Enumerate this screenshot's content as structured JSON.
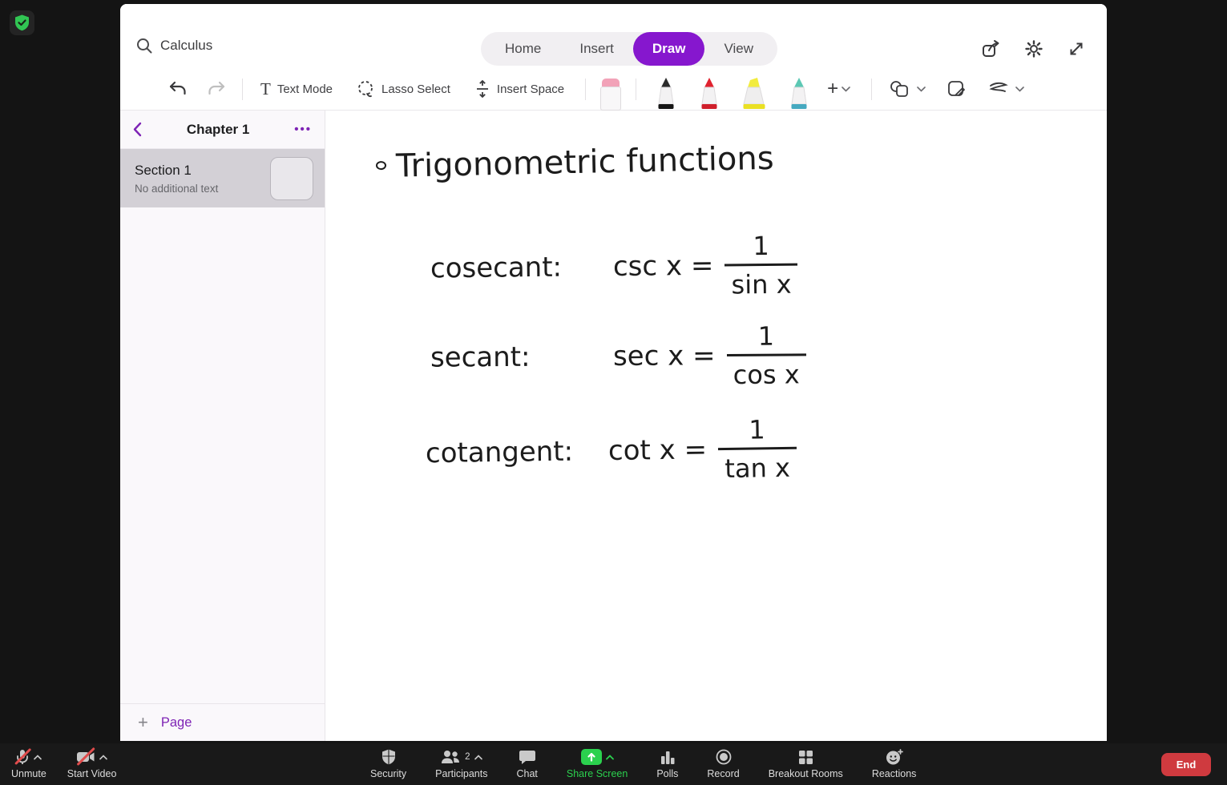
{
  "colors": {
    "accent_purple": "#8617ce",
    "sidebar_purple": "#7e23b5",
    "share_green": "#2bd14e",
    "end_red": "#cf3a3f",
    "shield_green": "#31c553",
    "ink": "#1c1c1c"
  },
  "notebook": {
    "search": {
      "value": "Calculus",
      "icon": "search-icon"
    },
    "tabs": [
      {
        "label": "Home",
        "active": false
      },
      {
        "label": "Insert",
        "active": false
      },
      {
        "label": "Draw",
        "active": true
      },
      {
        "label": "View",
        "active": false
      }
    ],
    "window_icons": [
      "share-icon",
      "settings-gear-icon",
      "expand-icon"
    ],
    "draw_toolbar": {
      "undo_icon": "undo-arrow",
      "redo_icon": "redo-arrow",
      "text_mode": "Text Mode",
      "lasso_select": "Lasso Select",
      "insert_space": "Insert Space",
      "pens": [
        "eraser",
        "black-pen",
        "red-pen",
        "yellow-highlighter",
        "teal-pen"
      ],
      "add_pen": "+",
      "extra_icons": [
        "shapes-icon",
        "note-pen-icon",
        "ink-squiggle-icon"
      ]
    },
    "sidebar": {
      "title": "Chapter 1",
      "menu": "•••",
      "section": {
        "title": "Section 1",
        "subtitle": "No additional text",
        "selected": true
      },
      "add_page": "Page"
    },
    "page": {
      "title": "Trigonometric functions",
      "formulas": [
        {
          "name": "cosecant:",
          "lhs": "csc x =",
          "numerator": "1",
          "denominator": "sin x"
        },
        {
          "name": "secant:",
          "lhs": "sec x =",
          "numerator": "1",
          "denominator": "cos x"
        },
        {
          "name": "cotangent:",
          "lhs": "cot x =",
          "numerator": "1",
          "denominator": "tan x"
        }
      ]
    }
  },
  "zoom_bar": {
    "unmute": "Unmute",
    "start_video": "Start Video",
    "security": "Security",
    "participants": "Participants",
    "participants_count": "2",
    "chat": "Chat",
    "share_screen": "Share Screen",
    "polls": "Polls",
    "record": "Record",
    "breakout_rooms": "Breakout Rooms",
    "reactions": "Reactions",
    "end": "End"
  }
}
